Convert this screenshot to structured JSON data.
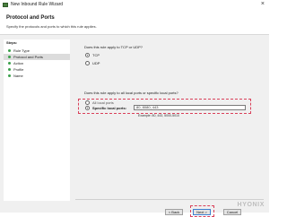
{
  "window": {
    "title": "New Inbound Rule Wizard",
    "close_glyph": "×",
    "icon": "firewall-icon"
  },
  "header": {
    "title": "Protocol and Ports",
    "description": "Specify the protocols and ports to which this rule applies."
  },
  "steps": {
    "title": "Steps:",
    "items": [
      {
        "label": "Rule Type",
        "active": false
      },
      {
        "label": "Protocol and Ports",
        "active": true
      },
      {
        "label": "Action",
        "active": false
      },
      {
        "label": "Profile",
        "active": false
      },
      {
        "label": "Name",
        "active": false
      }
    ]
  },
  "protocol": {
    "question": "Does this rule apply to TCP or UDP?",
    "options": [
      {
        "label": "TCP",
        "checked": true
      },
      {
        "label": "UDP",
        "checked": false
      }
    ]
  },
  "ports": {
    "question": "Does this rule apply to all local ports or specific local ports?",
    "options": [
      {
        "label": "All local ports",
        "checked": false
      },
      {
        "label": "Specific local ports:",
        "checked": true
      }
    ],
    "value": "80, 8080, 443",
    "example": "Example: 80, 443, 5000-5010"
  },
  "buttons": {
    "back": "< Back",
    "next": "Next >",
    "cancel": "Cancel"
  },
  "brand": {
    "text": "HYONIX"
  },
  "colors": {
    "highlight": "#d9405a",
    "step_dot": "#3aa04a",
    "focus": "#3d7fcf"
  }
}
